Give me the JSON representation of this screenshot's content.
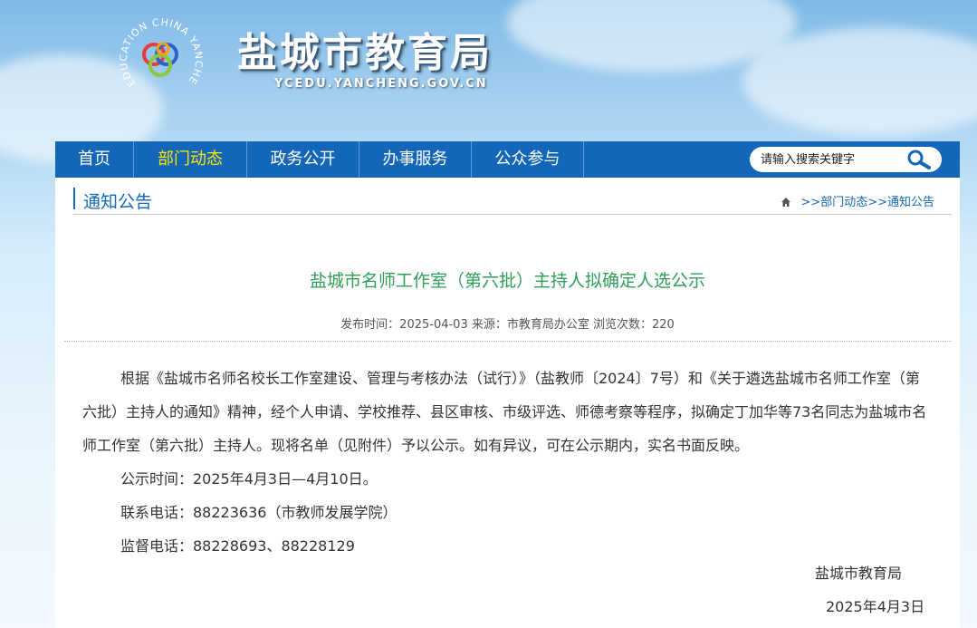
{
  "header": {
    "site_title": "盐城市教育局",
    "site_url": "YCEDU.YANCHENG.GOV.CN",
    "logo_text": "EDUCATION CHINA YANCHENG"
  },
  "nav": {
    "items": [
      {
        "label": "首页"
      },
      {
        "label": "部门动态"
      },
      {
        "label": "政务公开"
      },
      {
        "label": "办事服务"
      },
      {
        "label": "公众参与"
      }
    ],
    "active_color": "#ffe600",
    "bg_color": "#1467b8"
  },
  "search": {
    "placeholder": "请输入搜索关键字"
  },
  "section": {
    "title": "通知公告",
    "breadcrumb": [
      ">>部门动态",
      ">>通知公告"
    ]
  },
  "article": {
    "title": "盐城市名师工作室（第六批）主持人拟确定人选公示",
    "meta": "发布时间：2025-04-03 来源：市教育局办公室 浏览次数：220",
    "paragraph": "根据《盐城市名师名校长工作室建设、管理与考核办法（试行）》（盐教师〔2024〕7号）和《关于遴选盐城市名师工作室（第六批）主持人的通知》精神，经个人申请、学校推荐、县区审核、市级评选、师德考察等程序，拟确定丁加华等73名同志为盐城市名师工作室（第六批）主持人。现将名单（见附件）予以公示。如有异议，可在公示期内，实名书面反映。",
    "period": "公示时间：2025年4月3日—4月10日。",
    "contact": "联系电话：88223636（市教师发展学院）",
    "supervise": "监督电话：88228693、88228129",
    "signature": "盐城市教育局",
    "date": "2025年4月3日"
  }
}
